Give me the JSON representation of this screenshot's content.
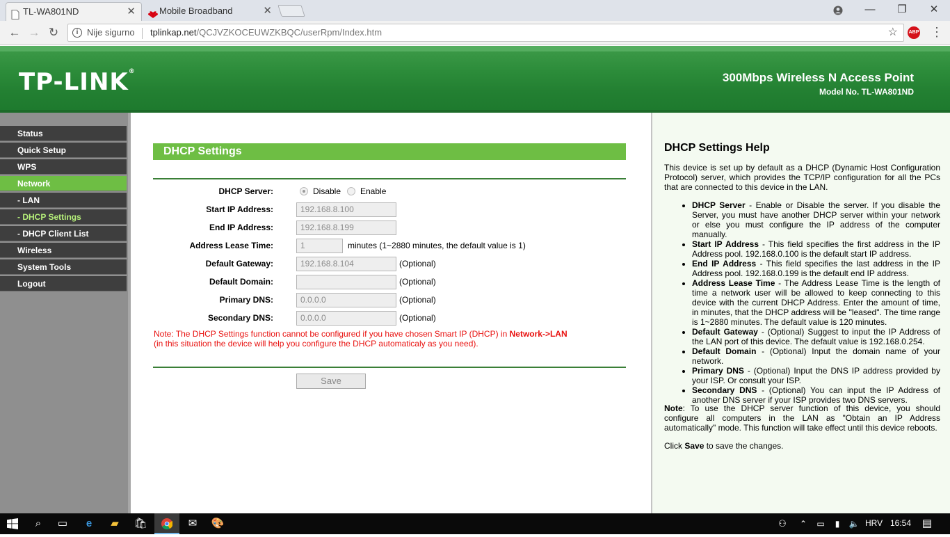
{
  "browser": {
    "tabs": [
      {
        "title": "TL-WA801ND",
        "active": true
      },
      {
        "title": "Mobile Broadband",
        "active": false
      }
    ],
    "security_label": "Nije sigurno",
    "url_host": "tplinkap.net",
    "url_path": "/QCJVZKOCEUWZKBQC/userRpm/Index.htm",
    "extension_label": "ABP"
  },
  "header": {
    "logo": "TP-LINK",
    "product": "300Mbps Wireless N Access Point",
    "model": "Model No. TL-WA801ND"
  },
  "sidebar": {
    "items": [
      {
        "label": "Status"
      },
      {
        "label": "Quick Setup"
      },
      {
        "label": "WPS"
      },
      {
        "label": "Network"
      },
      {
        "label": "- LAN"
      },
      {
        "label": "- DHCP Settings"
      },
      {
        "label": "- DHCP Client List"
      },
      {
        "label": "Wireless"
      },
      {
        "label": "System Tools"
      },
      {
        "label": "Logout"
      }
    ]
  },
  "form": {
    "title": "DHCP Settings",
    "dhcp_server_label": "DHCP Server:",
    "disable_label": "Disable",
    "enable_label": "Enable",
    "selected": "Disable",
    "start_ip_label": "Start IP Address:",
    "start_ip": "192.168.8.100",
    "end_ip_label": "End IP Address:",
    "end_ip": "192.168.8.199",
    "lease_label": "Address Lease Time:",
    "lease": "1",
    "lease_hint": "minutes (1~2880 minutes, the default value is 1)",
    "gateway_label": "Default Gateway:",
    "gateway": "192.168.8.104",
    "domain_label": "Default Domain:",
    "domain": "",
    "dns1_label": "Primary DNS:",
    "dns1": "0.0.0.0",
    "dns2_label": "Secondary DNS:",
    "dns2": "0.0.0.0",
    "optional": "(Optional)",
    "note_1": "Note: The DHCP Settings function cannot be configured if you have chosen Smart IP (DHCP) in ",
    "note_link": "Network->LAN",
    "note_2": "(in this situation the device will help you configure the DHCP automaticaly as you need).",
    "save_label": "Save"
  },
  "help": {
    "title": "DHCP Settings Help",
    "intro": "This device is set up by default as a DHCP (Dynamic Host Configuration Protocol) server, which provides the TCP/IP configuration for all the PCs that are connected to this device in the LAN.",
    "items": [
      {
        "term": "DHCP Server",
        "text": " - Enable or Disable the server. If you disable the Server, you must have another DHCP server within your network or else you must configure the IP address of the computer manually."
      },
      {
        "term": "Start IP Address",
        "text": " - This field specifies the first address in the IP Address pool. 192.168.0.100 is the default start IP address."
      },
      {
        "term": "End IP Address",
        "text": " - This field specifies the last address in the IP Address pool. 192.168.0.199 is the default end IP address."
      },
      {
        "term": "Address Lease Time",
        "text": " - The Address Lease Time is the length of time a network user will be allowed to keep connecting to this device with the current DHCP Address. Enter the amount of time, in minutes, that the DHCP address will be \"leased\". The time range is 1~2880 minutes. The default value is 120 minutes."
      },
      {
        "term": "Default Gateway",
        "text": " - (Optional) Suggest to input the IP Address of the LAN port of this device. The default value is 192.168.0.254."
      },
      {
        "term": "Default Domain",
        "text": " - (Optional) Input the domain name of your network."
      },
      {
        "term": "Primary DNS",
        "text": " - (Optional) Input the DNS IP address provided by your ISP. Or consult your ISP."
      },
      {
        "term": "Secondary DNS",
        "text": " - (Optional) You can input the IP Address of another DNS server if your ISP provides two DNS servers."
      }
    ],
    "note_term": "Note",
    "note_text": ": To use the DHCP server function of this device, you should configure all computers in the LAN as \"Obtain an IP Address automatically\" mode. This function will take effect until this device reboots.",
    "click_1": "Click ",
    "click_term": "Save",
    "click_2": " to save the changes."
  },
  "taskbar": {
    "language": "HRV",
    "time": "16:54"
  },
  "colors": {
    "accent_green": "#6ebe44",
    "banner_green": "#238032",
    "nav_dark": "#3e3e3e",
    "note_red": "#e8100e"
  }
}
